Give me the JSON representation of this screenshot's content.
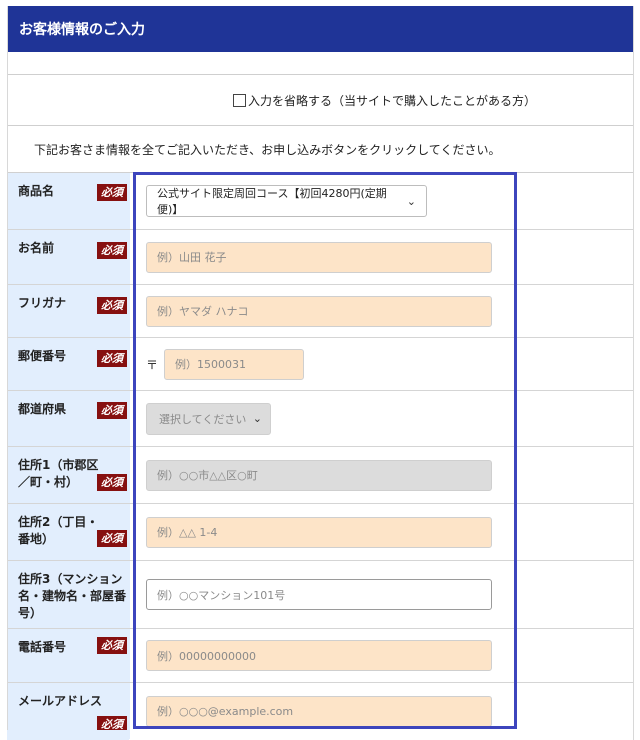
{
  "header": {
    "title": "お客様情報のご入力"
  },
  "skip": {
    "label": "入力を省略する（当サイトで購入したことがある方）",
    "checked": false
  },
  "note": "下記お客さま情報を全てご記入いただき、お申し込みボタンをクリックしてください。",
  "required_label": "必須",
  "postal_mark": "〒",
  "rows": {
    "product": {
      "label": "商品名",
      "value": "公式サイト限定周回コース【初回4280円(定期便)】"
    },
    "name": {
      "label": "お名前",
      "placeholder": "例）山田 花子"
    },
    "kana": {
      "label": "フリガナ",
      "placeholder": "例）ヤマダ ハナコ"
    },
    "postal": {
      "label": "郵便番号",
      "placeholder": "例）1500031"
    },
    "pref": {
      "label": "都道府県",
      "value": "選択してください"
    },
    "addr1": {
      "label": "住所1（市郡区／町・村）",
      "placeholder": "例）○○市△△区○町"
    },
    "addr2": {
      "label": "住所2（丁目・番地）",
      "placeholder": "例）△△ 1-4"
    },
    "addr3": {
      "label": "住所3（マンション名・建物名・部屋番号）",
      "placeholder": "例）○○マンション101号"
    },
    "tel": {
      "label": "電話番号",
      "placeholder": "例）00000000000"
    },
    "email": {
      "label": "メールアドレス",
      "placeholder": "例）○○○@example.com"
    }
  },
  "colors": {
    "header_bg": "#1f3497",
    "label_bg": "#e2eefd",
    "required_bg": "#861010",
    "input_bg": "#fde4c8",
    "outline": "#3d45bd"
  },
  "icons": {
    "select": "chevron-down-icon"
  }
}
